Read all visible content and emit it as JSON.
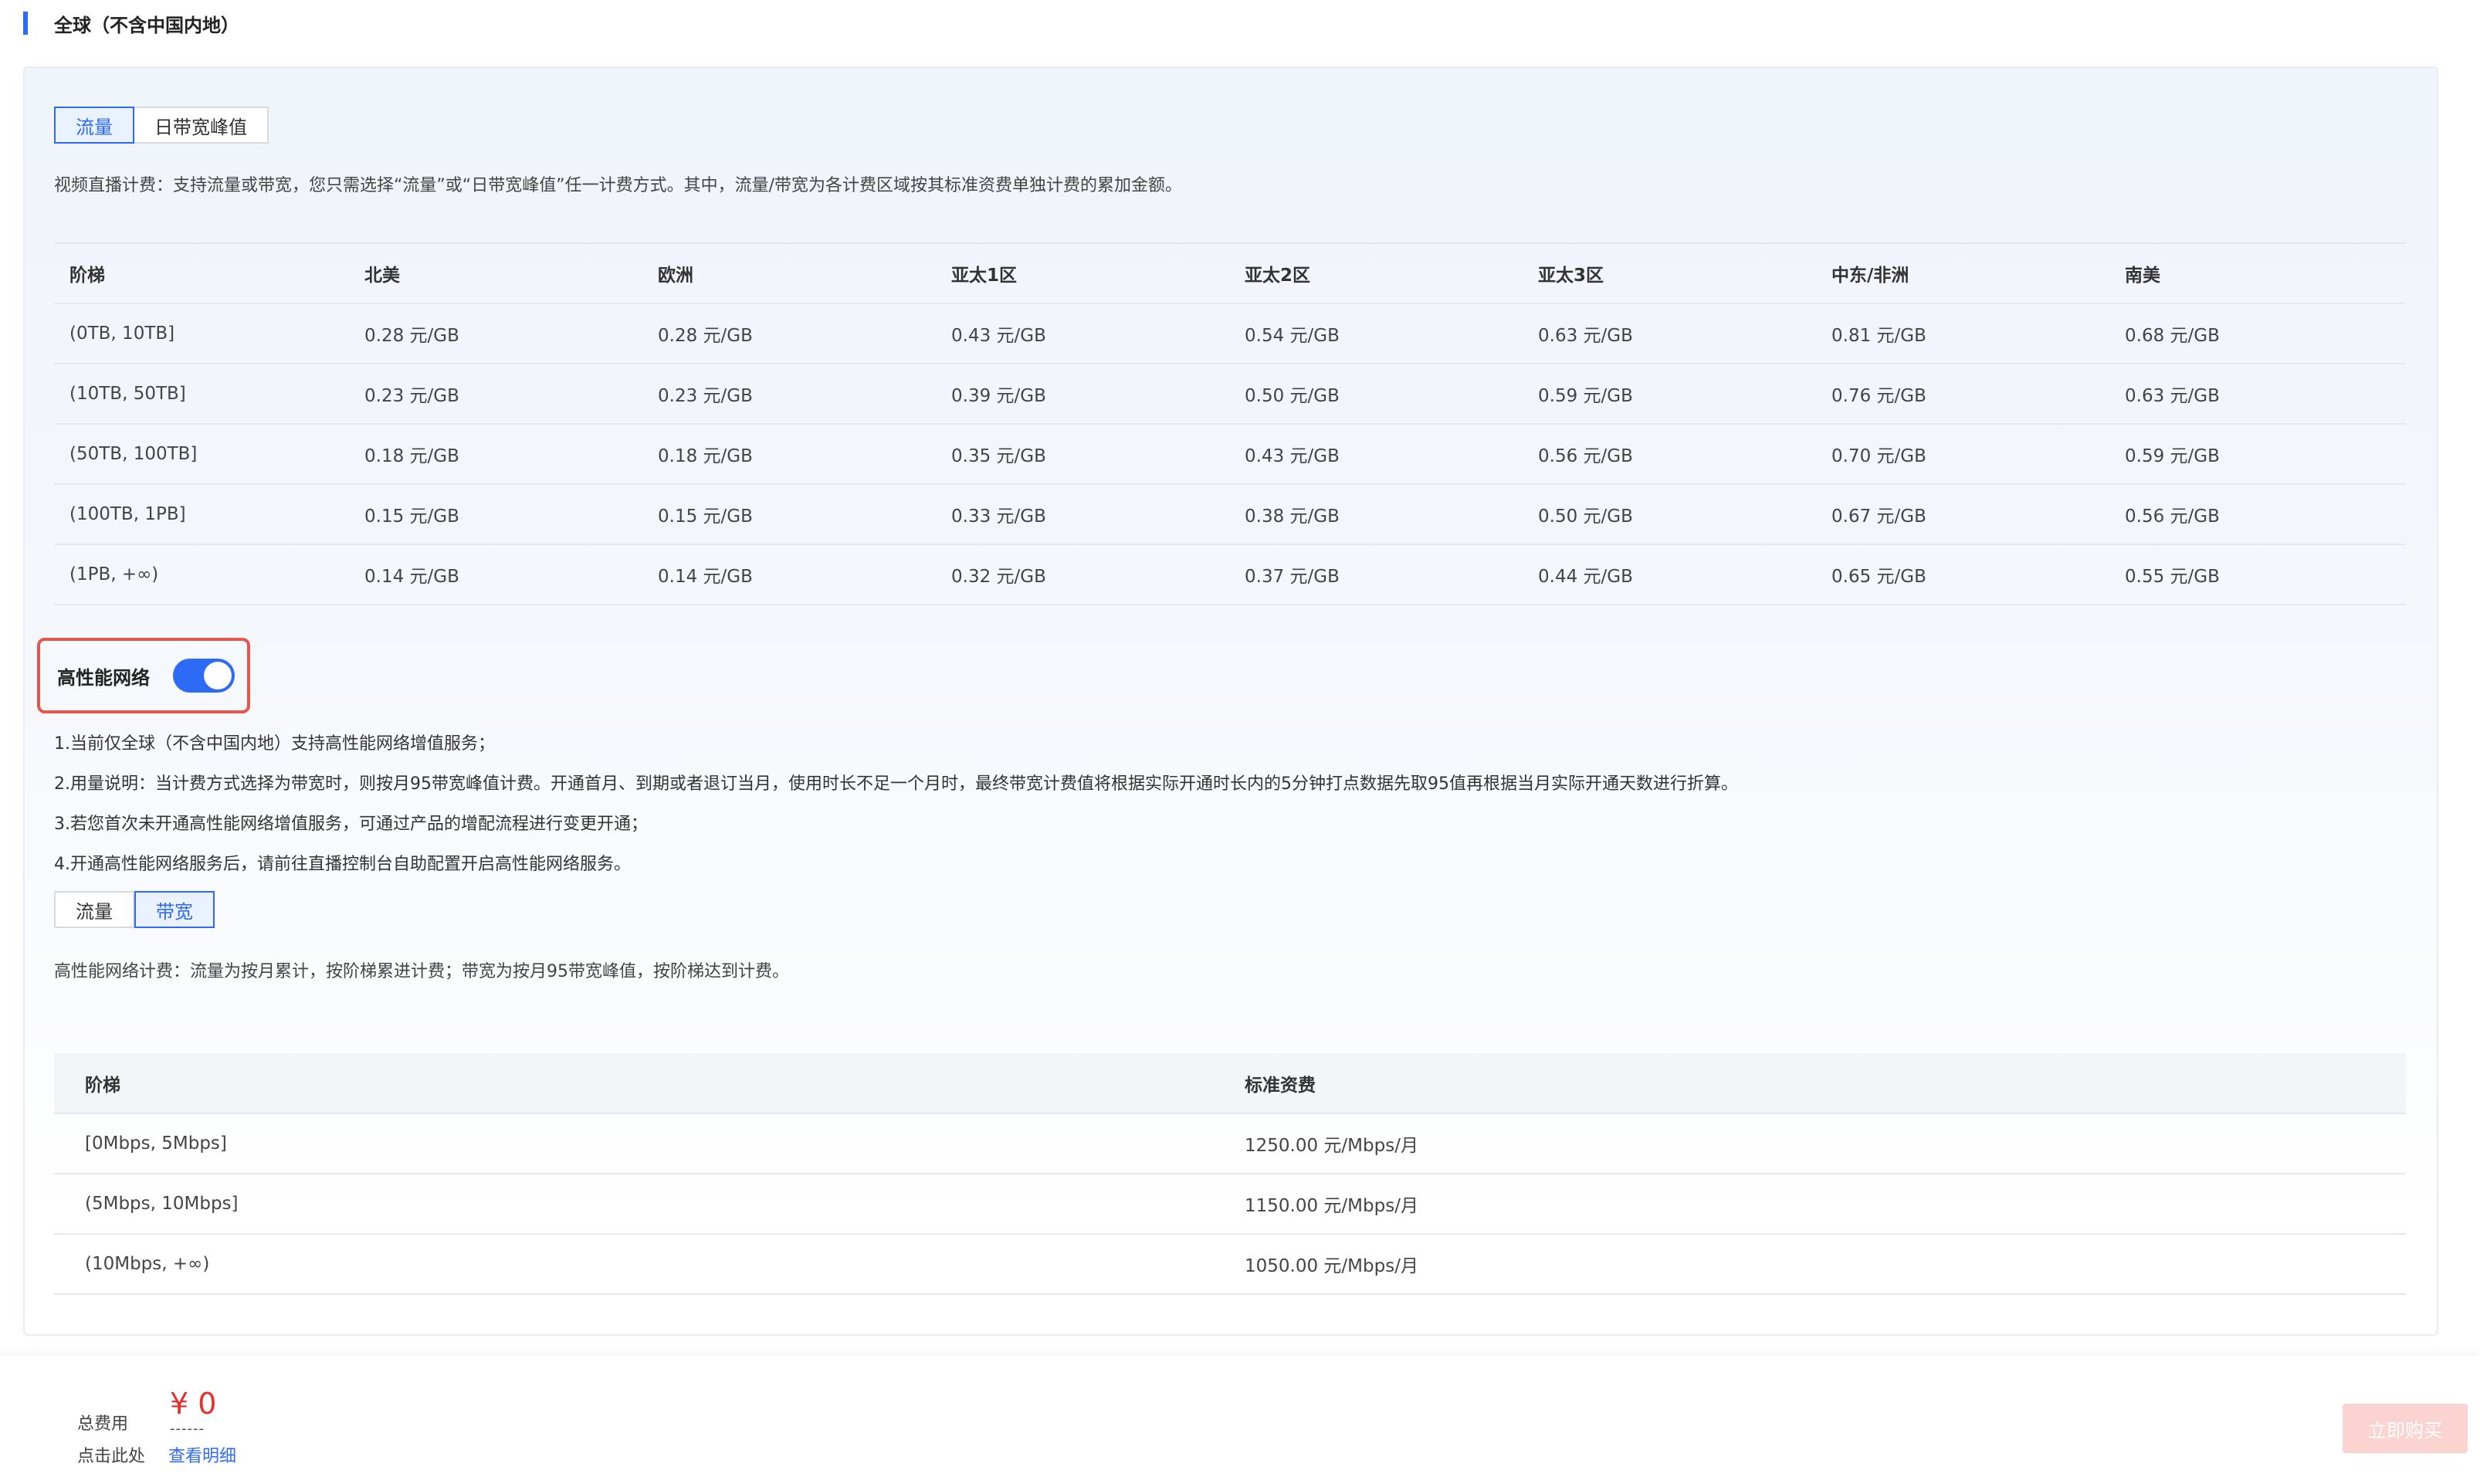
{
  "section": {
    "title": "全球（不含中国内地）"
  },
  "live": {
    "tabs": [
      {
        "label": "流量",
        "active": true
      },
      {
        "label": "日带宽峰值",
        "active": false
      }
    ],
    "description": "视频直播计费：支持流量或带宽，您只需选择“流量”或“日带宽峰值”任一计费方式。其中，流量/带宽为各计费区域按其标准资费单独计费的累加金额。",
    "table": {
      "headers": [
        "阶梯",
        "北美",
        "欧洲",
        "亚太1区",
        "亚太2区",
        "亚太3区",
        "中东/非洲",
        "南美"
      ],
      "rows": [
        [
          "(0TB, 10TB]",
          "0.28 元/GB",
          "0.28 元/GB",
          "0.43 元/GB",
          "0.54 元/GB",
          "0.63 元/GB",
          "0.81 元/GB",
          "0.68 元/GB"
        ],
        [
          "(10TB, 50TB]",
          "0.23 元/GB",
          "0.23 元/GB",
          "0.39 元/GB",
          "0.50 元/GB",
          "0.59 元/GB",
          "0.76 元/GB",
          "0.63 元/GB"
        ],
        [
          "(50TB, 100TB]",
          "0.18 元/GB",
          "0.18 元/GB",
          "0.35 元/GB",
          "0.43 元/GB",
          "0.56 元/GB",
          "0.70 元/GB",
          "0.59 元/GB"
        ],
        [
          "(100TB, 1PB]",
          "0.15 元/GB",
          "0.15 元/GB",
          "0.33 元/GB",
          "0.38 元/GB",
          "0.50 元/GB",
          "0.67 元/GB",
          "0.56 元/GB"
        ],
        [
          "(1PB, +∞)",
          "0.14 元/GB",
          "0.14 元/GB",
          "0.32 元/GB",
          "0.37 元/GB",
          "0.44 元/GB",
          "0.65 元/GB",
          "0.55 元/GB"
        ]
      ]
    }
  },
  "hpn": {
    "label": "高性能网络",
    "enabled": true,
    "notes": [
      "1.当前仅全球（不含中国内地）支持高性能网络增值服务；",
      "2.用量说明：当计费方式选择为带宽时，则按月95带宽峰值计费。开通首月、到期或者退订当月，使用时长不足一个月时，最终带宽计费值将根据实际开通时长内的5分钟打点数据先取95值再根据当月实际开通天数进行折算。",
      "3.若您首次未开通高性能网络增值服务，可通过产品的增配流程进行变更开通；",
      "4.开通高性能网络服务后，请前往直播控制台自助配置开启高性能网络服务。"
    ],
    "tabs": [
      {
        "label": "流量",
        "active": false
      },
      {
        "label": "带宽",
        "active": true
      }
    ],
    "description": "高性能网络计费：流量为按月累计，按阶梯累进计费；带宽为按月95带宽峰值，按阶梯达到计费。",
    "table": {
      "headers": [
        "阶梯",
        "标准资费"
      ],
      "rows": [
        [
          "[0Mbps, 5Mbps]",
          "1250.00 元/Mbps/月"
        ],
        [
          "(5Mbps, 10Mbps]",
          "1150.00 元/Mbps/月"
        ],
        [
          "(10Mbps, +∞)",
          "1050.00 元/Mbps/月"
        ]
      ]
    }
  },
  "footer": {
    "total_label": "总费用",
    "total_amount": "¥ 0",
    "total_dashes": "------",
    "hint_label": "点击此处",
    "detail_link": "查看明细",
    "buy_button": "立即购买"
  },
  "colors": {
    "accent": "#2d6af6",
    "price_red": "#e5302b",
    "highlight_border": "#e5574c",
    "buy_disabled": "#fbd3d0"
  }
}
